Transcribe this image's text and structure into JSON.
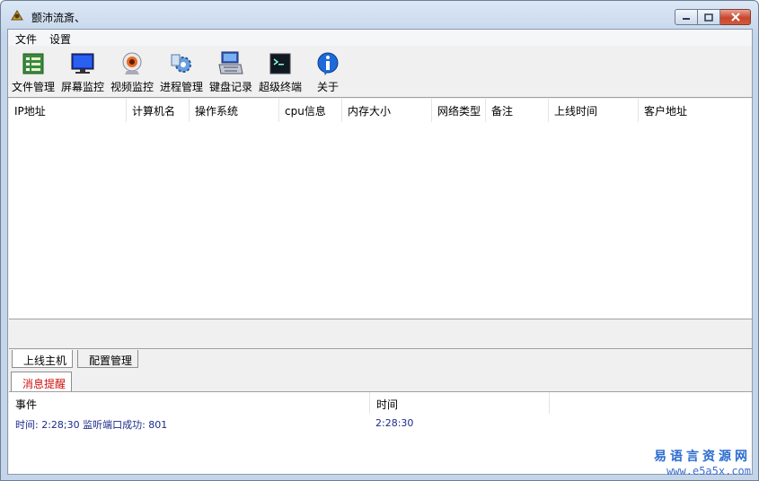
{
  "window": {
    "title": "颤沛流斎、"
  },
  "menu": [
    {
      "label": "文件"
    },
    {
      "label": "设置"
    }
  ],
  "toolbar": [
    {
      "label": "文件管理",
      "icon": "file-manager-icon"
    },
    {
      "label": "屏幕监控",
      "icon": "monitor-icon"
    },
    {
      "label": "视频监控",
      "icon": "webcam-icon"
    },
    {
      "label": "进程管理",
      "icon": "process-gear-icon"
    },
    {
      "label": "键盘记录",
      "icon": "keyboard-icon"
    },
    {
      "label": "超级终端",
      "icon": "terminal-icon"
    },
    {
      "label": "关于",
      "icon": "info-icon"
    }
  ],
  "hosts_table": {
    "columns": [
      "IP地址",
      "计算机名",
      "操作系统",
      "cpu信息",
      "内存大小",
      "网络类型",
      "备注",
      "上线时间",
      "客户地址"
    ],
    "rows": []
  },
  "tabs": [
    {
      "label": "上线主机"
    },
    {
      "label": "配置管理"
    }
  ],
  "message_tab": {
    "label": "消息提醒"
  },
  "events_table": {
    "columns": [
      "事件",
      "时间"
    ],
    "rows": [
      {
        "event": "时间: 2:28;30    监听端口成功: 801",
        "time": "2:28:30"
      }
    ]
  },
  "watermark": {
    "line1": "易语言资源网",
    "line2": "www.e5a5x.com"
  },
  "colors": {
    "titlebar": "#c4d5ea",
    "close_button": "#c9452c",
    "message_tab_text": "#d01010",
    "event_text": "#1a2a8a",
    "watermark": "#2a6bd1"
  }
}
